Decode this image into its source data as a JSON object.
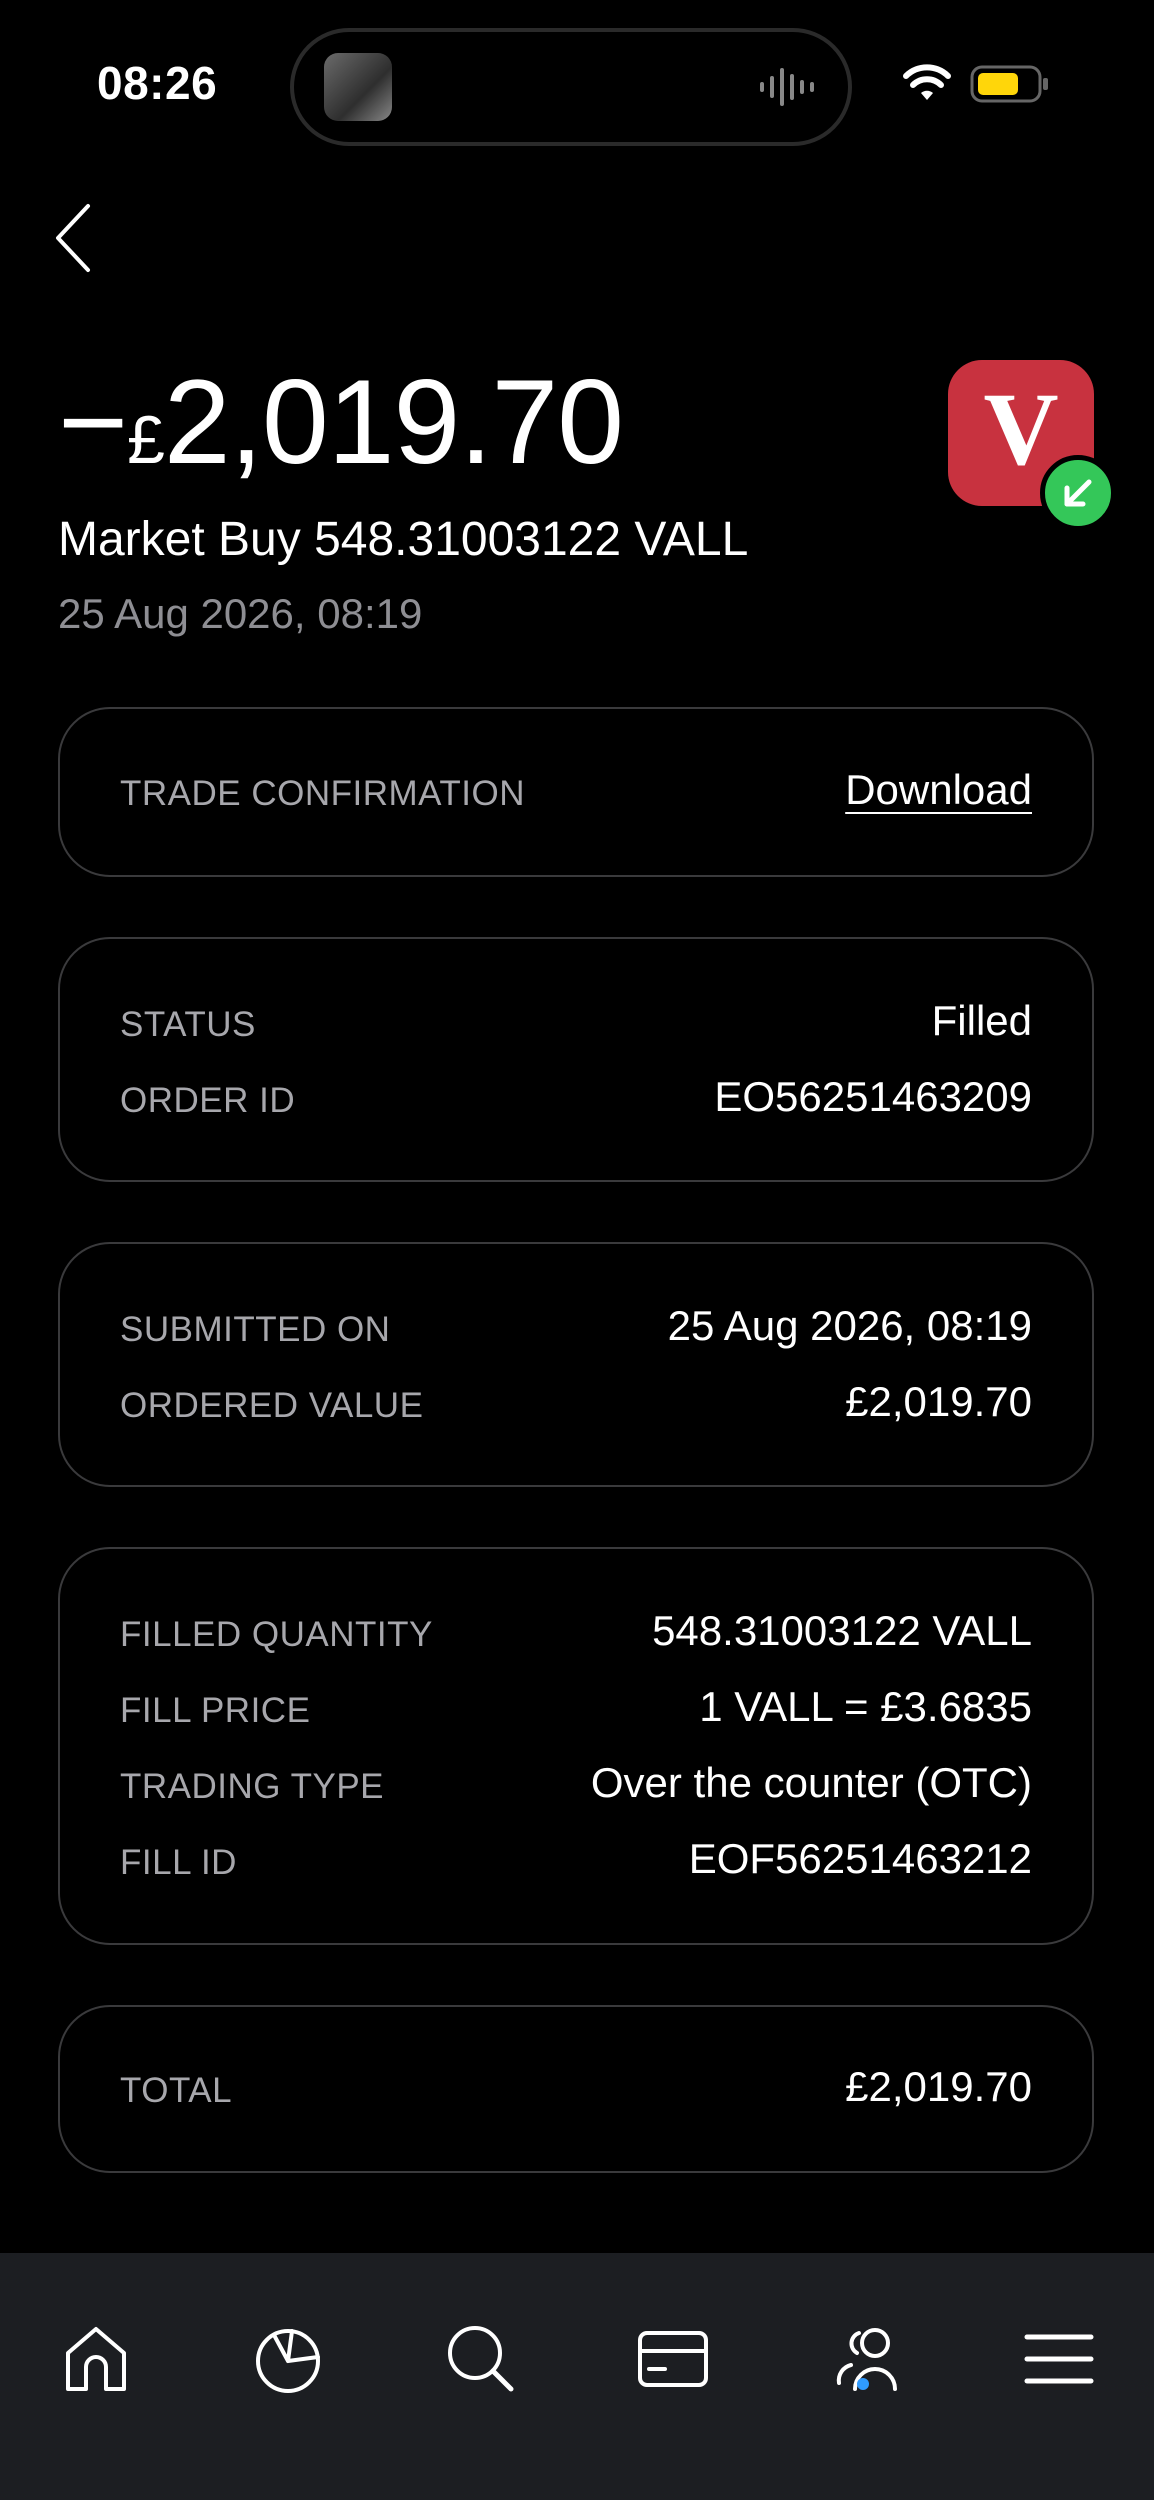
{
  "status_bar": {
    "time": "08:26"
  },
  "header": {
    "amount_sign": "−",
    "amount_currency": "£",
    "amount_value": "2,019.70",
    "title": "Market Buy 548.31003122 VALL",
    "date": "25 Aug 2026, 08:19",
    "logo_letter": "V",
    "logo_color": "#c8323f",
    "badge_color": "#34c759"
  },
  "cards": {
    "trade_confirmation": {
      "label": "TRADE CONFIRMATION",
      "action": "Download"
    },
    "status": [
      {
        "label": "STATUS",
        "value": "Filled"
      },
      {
        "label": "ORDER ID",
        "value": "EO56251463209"
      }
    ],
    "submitted": [
      {
        "label": "SUBMITTED ON",
        "value": "25 Aug 2026, 08:19"
      },
      {
        "label": "ORDERED VALUE",
        "value": "£2,019.70"
      }
    ],
    "fill": [
      {
        "label": "FILLED QUANTITY",
        "value": "548.31003122 VALL"
      },
      {
        "label": "FILL PRICE",
        "value": "1 VALL = £3.6835"
      },
      {
        "label": "TRADING TYPE",
        "value": "Over the counter (OTC)"
      },
      {
        "label": "FILL ID",
        "value": "EOF56251463212"
      }
    ],
    "total": {
      "label": "TOTAL",
      "value": "£2,019.70"
    }
  },
  "nav": {
    "items": [
      "home-icon",
      "pie-chart-icon",
      "search-icon",
      "card-icon",
      "people-icon",
      "menu-icon"
    ],
    "active_index": 4,
    "active_color": "#2f9bff"
  }
}
